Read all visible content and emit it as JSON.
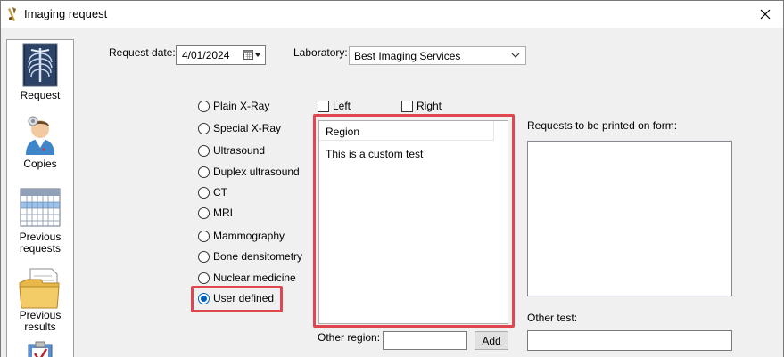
{
  "window": {
    "title": "Imaging request"
  },
  "sidebar": {
    "items": [
      {
        "label_lines": [
          "Request"
        ],
        "icon": "xray-icon"
      },
      {
        "label_lines": [
          "Copies"
        ],
        "icon": "doctor-icon"
      },
      {
        "label_lines": [
          "Previous",
          "requests"
        ],
        "icon": "calendar-icon"
      },
      {
        "label_lines": [
          "Previous",
          "results"
        ],
        "icon": "folder-icon"
      },
      {
        "label_lines": [],
        "icon": "clipboard-check-icon"
      }
    ]
  },
  "form": {
    "request_date_label": "Request date:",
    "request_date_value": "4/01/2024",
    "laboratory_label": "Laboratory:",
    "laboratory_value": "Best Imaging Services",
    "modalities": [
      {
        "label": "Plain X-Ray",
        "selected": false
      },
      {
        "label": "Special X-Ray",
        "selected": false
      },
      {
        "label": "Ultrasound",
        "selected": false
      },
      {
        "label": "Duplex ultrasound",
        "selected": false
      },
      {
        "label": "CT",
        "selected": false
      },
      {
        "label": "MRI",
        "selected": false
      },
      {
        "label": "Mammography",
        "selected": false
      },
      {
        "label": "Bone densitometry",
        "selected": false
      },
      {
        "label": "Nuclear medicine",
        "selected": false
      },
      {
        "label": "User defined",
        "selected": true
      }
    ],
    "left_label": "Left",
    "right_label": "Right",
    "region_header": "Region",
    "region_rows": [
      "This is a custom test"
    ],
    "other_region_label": "Other region:",
    "other_region_value": "",
    "add_label": "Add",
    "printed_label": "Requests to be printed on form:",
    "other_test_label": "Other test:",
    "other_test_value": ""
  },
  "colors": {
    "highlight": "#e0464f",
    "radio_selected": "#005fb8"
  }
}
